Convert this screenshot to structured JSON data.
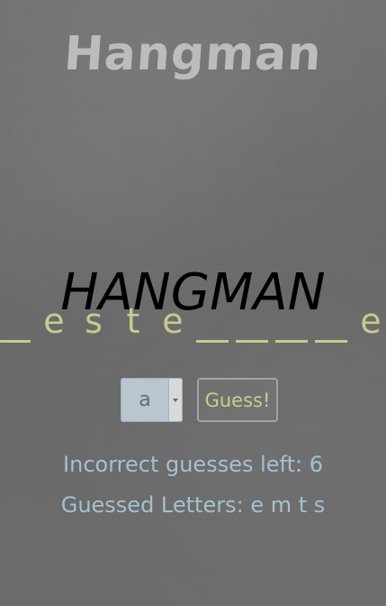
{
  "header": {
    "title": "Hangman"
  },
  "board": {
    "title": "HANGMAN",
    "letters": [
      "",
      "e",
      "s",
      "t",
      "e",
      "",
      "",
      "",
      "",
      "e"
    ]
  },
  "controls": {
    "selected_letter": "a",
    "guess_label": "Guess!"
  },
  "status": {
    "incorrect_guesses": "Incorrect guesses left: 6",
    "guessed_letters": "Guessed Letters: e m t s"
  },
  "colors": {
    "background": "#6b6b6b",
    "word_letters": "#c8c98f",
    "status_text": "#a6c0cf",
    "guess_button_text": "#cccc88"
  }
}
